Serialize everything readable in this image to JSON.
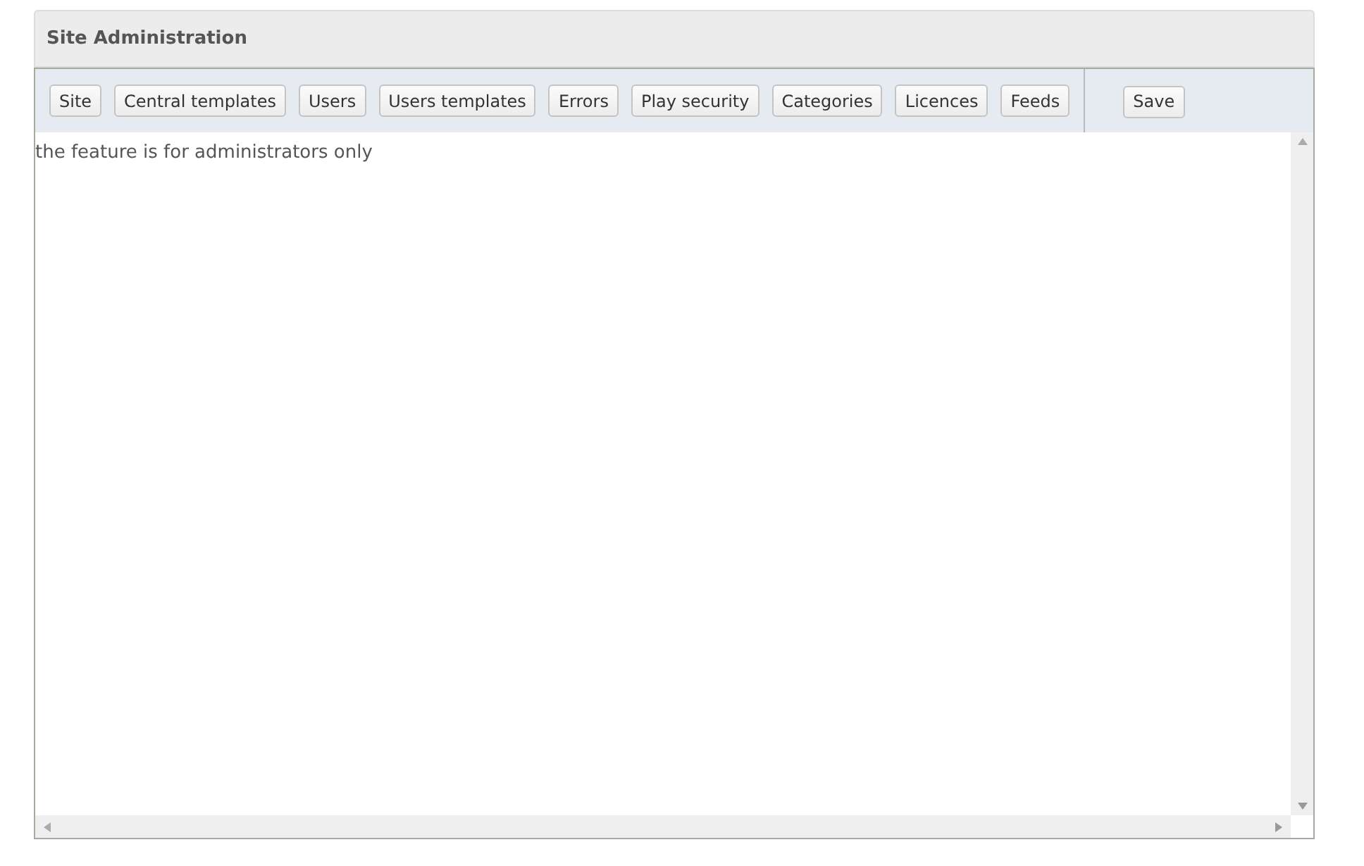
{
  "panel": {
    "title": "Site Administration"
  },
  "toolbar": {
    "buttons": [
      "Site",
      "Central templates",
      "Users",
      "Users templates",
      "Errors",
      "Play security",
      "Categories",
      "Licences",
      "Feeds"
    ],
    "save": "Save"
  },
  "content": {
    "text": "the feature is for administrators only"
  }
}
